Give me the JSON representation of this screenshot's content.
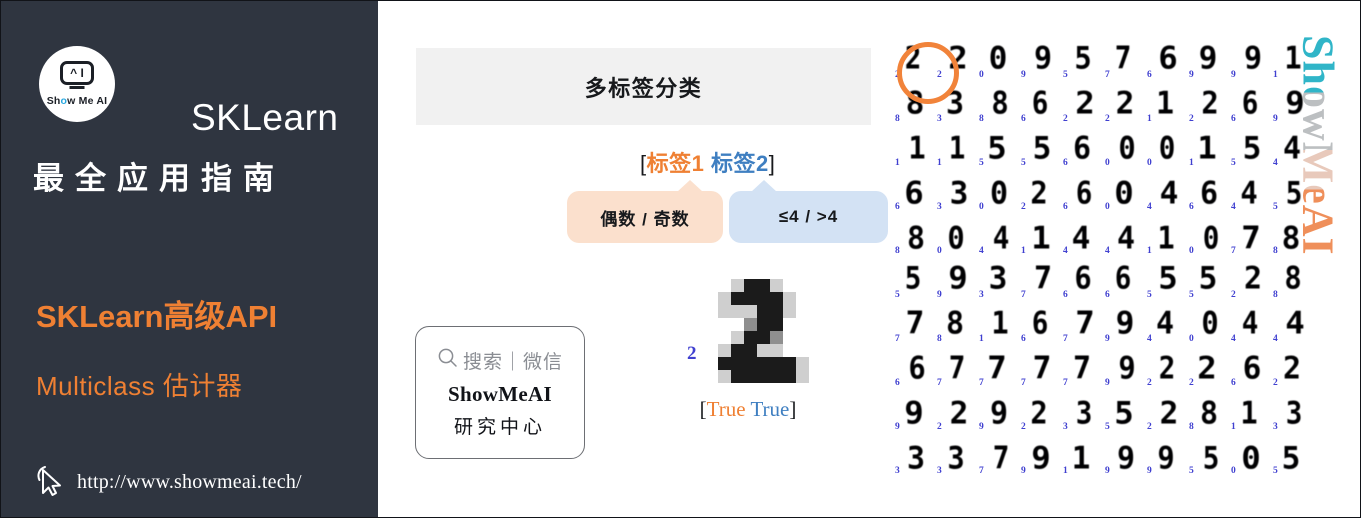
{
  "sidebar": {
    "logo": {
      "icon": "showmeai-robot-logo",
      "robot_glyph": "^ I",
      "wordmark_pre": "Sh",
      "wordmark_dot": "o",
      "wordmark_post": "w Me AI"
    },
    "brand_title": "SKLearn",
    "brand_subtitle": "最全应用指南",
    "topic_main": "SKLearn高级API",
    "topic_sub": "Multiclass 估计器",
    "footer_url": "http://www.showmeai.tech/",
    "cursor_icon": "mouse-pointer-icon",
    "bg_color": "#2f3540",
    "accent_color": "#ef8033"
  },
  "main": {
    "header_title": "多标签分类",
    "labels_row": {
      "open_bracket": "[",
      "label_1": "标签1",
      "gap": " ",
      "label_2": "标签2",
      "close_bracket": "]"
    },
    "callouts": [
      {
        "text": "偶数 / 奇数",
        "color": "#fbe0cd",
        "tail": "right"
      },
      {
        "text": "≤4 / >4",
        "color": "#d3e2f4",
        "tail": "left"
      }
    ],
    "wechat_card": {
      "search_icon": "magnifier-icon",
      "search_text": "搜索｜微信",
      "brand": "ShowMeAI",
      "center": "研究中心"
    },
    "sample": {
      "index_label": "2",
      "prediction_open": "[",
      "prediction_1": "True",
      "prediction_gap": " ",
      "prediction_2": "True",
      "prediction_close": "]",
      "pixels": [
        [
          0,
          0,
          1,
          3,
          3,
          1,
          0,
          0
        ],
        [
          0,
          1,
          3,
          3,
          3,
          3,
          1,
          0
        ],
        [
          0,
          1,
          1,
          1,
          3,
          3,
          1,
          0
        ],
        [
          0,
          0,
          0,
          2,
          3,
          3,
          0,
          0
        ],
        [
          0,
          0,
          1,
          3,
          3,
          2,
          0,
          0
        ],
        [
          0,
          1,
          3,
          3,
          1,
          1,
          0,
          0
        ],
        [
          0,
          3,
          3,
          3,
          3,
          3,
          3,
          1
        ],
        [
          0,
          1,
          3,
          3,
          3,
          3,
          3,
          1
        ]
      ]
    }
  },
  "digit_grid": {
    "highlight_cell": 0,
    "highlight_color": "#f1833a",
    "label_color": "#4040d0",
    "rows": [
      {
        "digits": [
          "2",
          "2",
          "0",
          "9",
          "5",
          "7",
          "6",
          "9",
          "9",
          "1"
        ],
        "labels": [
          "2",
          "2",
          "0",
          "9",
          "5",
          "7",
          "6",
          "9",
          "9",
          "1"
        ]
      },
      {
        "digits": [
          "8",
          "3",
          "8",
          "6",
          "2",
          "2",
          "1",
          "2",
          "6",
          "9"
        ],
        "labels": [
          "8",
          "3",
          "8",
          "6",
          "2",
          "2",
          "1",
          "2",
          "6",
          "9"
        ]
      },
      {
        "digits": [
          "1",
          "1",
          "5",
          "5",
          "6",
          "0",
          "0",
          "1",
          "5",
          "4"
        ],
        "labels": [
          "1",
          "1",
          "5",
          "5",
          "6",
          "0",
          "0",
          "1",
          "5",
          "4"
        ]
      },
      {
        "digits": [
          "6",
          "3",
          "0",
          "2",
          "6",
          "0",
          "4",
          "6",
          "4",
          "5"
        ],
        "labels": [
          "6",
          "3",
          "0",
          "2",
          "6",
          "0",
          "4",
          "6",
          "4",
          "5"
        ]
      },
      {
        "digits": [
          "8",
          "0",
          "4",
          "1",
          "4",
          "4",
          "1",
          "0",
          "7",
          "8"
        ],
        "labels": [
          "8",
          "0",
          "4",
          "1",
          "4",
          "4",
          "1",
          "0",
          "7",
          "8"
        ]
      },
      {
        "digits": [
          "5",
          "9",
          "3",
          "7",
          "6",
          "6",
          "5",
          "5",
          "2",
          "8"
        ],
        "labels": [
          "5",
          "9",
          "3",
          "7",
          "6",
          "6",
          "5",
          "5",
          "2",
          "8"
        ]
      },
      {
        "digits": [
          "7",
          "8",
          "1",
          "6",
          "7",
          "9",
          "4",
          "0",
          "4",
          "4"
        ],
        "labels": [
          "7",
          "8",
          "1",
          "6",
          "7",
          "9",
          "4",
          "0",
          "4",
          "4"
        ]
      },
      {
        "digits": [
          "6",
          "7",
          "7",
          "7",
          "7",
          "9",
          "2",
          "2",
          "6",
          "2"
        ],
        "labels": [
          "6",
          "7",
          "7",
          "7",
          "7",
          "9",
          "2",
          "2",
          "6",
          "2"
        ]
      },
      {
        "digits": [
          "9",
          "2",
          "9",
          "2",
          "3",
          "5",
          "2",
          "8",
          "1",
          "3"
        ],
        "labels": [
          "9",
          "2",
          "9",
          "2",
          "3",
          "5",
          "2",
          "8",
          "1",
          "3"
        ]
      },
      {
        "digits": [
          "3",
          "3",
          "7",
          "9",
          "1",
          "9",
          "9",
          "5",
          "0",
          "5"
        ],
        "labels": [
          "3",
          "3",
          "7",
          "9",
          "1",
          "9",
          "9",
          "5",
          "0",
          "5"
        ]
      }
    ]
  },
  "watermark": {
    "text": "ShowMeAI"
  }
}
